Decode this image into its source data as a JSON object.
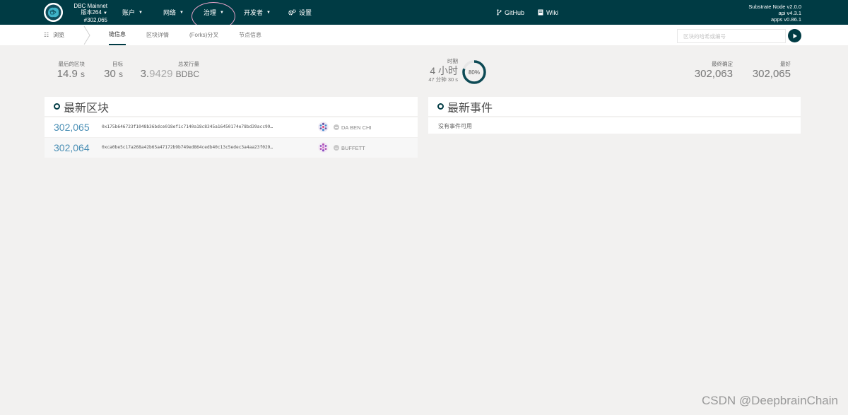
{
  "header": {
    "chain_name": "DBC Mainnet",
    "version": "版本264",
    "block": "#302,065",
    "nav": {
      "accounts": "账户",
      "network": "网络",
      "governance": "治理",
      "developer": "开发者",
      "settings": "设置",
      "github": "GitHub",
      "wiki": "Wiki"
    },
    "node": {
      "name": "Substrate Node v2.0.0",
      "api": "api v4.3.1",
      "apps": "apps v0.86.1"
    }
  },
  "subnav": {
    "section": "浏览",
    "tabs": [
      "链信息",
      "区块详情",
      "(Forks)分叉",
      "节点信息"
    ],
    "active_tab": 0,
    "search_placeholder": "区块的哈希或编号"
  },
  "stats": {
    "last_block": {
      "label": "最后的区块",
      "value": "14.9",
      "unit": "s"
    },
    "target": {
      "label": "目标",
      "value": "30",
      "unit": "s"
    },
    "issuance": {
      "label": "总发行量",
      "value_main": "3.",
      "value_dim": "9429",
      "unit": "BDBC"
    },
    "time": {
      "label": "时期",
      "value": "4 小时",
      "sub": "47 分钟 30 s",
      "progress_percent": 80,
      "progress_label": "80%"
    },
    "finalized": {
      "label": "最终确定",
      "value": "302,063"
    },
    "best": {
      "label": "最好",
      "value": "302,065"
    }
  },
  "blocks": {
    "title": "最新区块",
    "rows": [
      {
        "number": "302,065",
        "hash": "0x175b646723f1048b36bdce018ef1c7140a18c8345a16450174e78bd39acc99…",
        "author": "DA BEN CHI"
      },
      {
        "number": "302,064",
        "hash": "0xca0be5c17a268a42b65a47172b9b749ed864cedb40c13c5edec3a4aa23f029…",
        "author": "BUFFETT"
      }
    ]
  },
  "events": {
    "title": "最新事件",
    "empty": "没有事件可用"
  },
  "watermark": "CSDN @DeepbrainChain",
  "colors": {
    "topbar": "#003b44",
    "accent": "#003b44",
    "block_number": "#4a8fb5",
    "highlight_circle": "#e6a3c8"
  }
}
